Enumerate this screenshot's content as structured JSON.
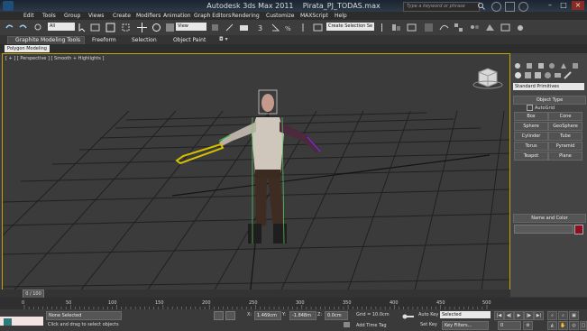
{
  "app": {
    "title": "Autodesk 3ds Max  2011",
    "file": "Pirata_PJ_TODAS.max",
    "search_placeholder": "Type a keyword or phrase"
  },
  "menu": [
    "Edit",
    "Tools",
    "Group",
    "Views",
    "Create",
    "Modifiers",
    "Animation",
    "Graph Editors",
    "Rendering",
    "Customize",
    "MAXScript",
    "Help"
  ],
  "toolbar": {
    "filter": "All",
    "refcoord": "View",
    "selection_set": "Create Selection Se"
  },
  "ribbon": {
    "tabs": [
      "Graphite Modeling Tools",
      "Freeform",
      "Selection",
      "Object Paint"
    ],
    "sub": "Polygon Modeling"
  },
  "viewport": {
    "label": "[ + ] [ Perspective ] [ Smooth + Highlights ]"
  },
  "command_panel": {
    "dropdown": "Standard Primitives",
    "rollout_object_type": "Object Type",
    "autogrid": "AutoGrid",
    "buttons": [
      "Box",
      "Cone",
      "Sphere",
      "GeoSphere",
      "Cylinder",
      "Tube",
      "Torus",
      "Pyramid",
      "Teapot",
      "Plane"
    ],
    "rollout_name_color": "Name and Color",
    "color": "#8a1022"
  },
  "timeline": {
    "frame": "0 / 100",
    "ticks": [
      "0",
      "50",
      "100",
      "150",
      "200",
      "250",
      "300",
      "350",
      "400",
      "450",
      "500"
    ]
  },
  "status": {
    "selection": "None Selected",
    "prompt": "Click and drag to select objects",
    "x_label": "X:",
    "x_value": "1.469cm",
    "y_label": "Y:",
    "y_value": "-1.848m",
    "z_label": "Z:",
    "z_value": "0.0cm",
    "grid": "Grid = 10.0cm",
    "add_time_tag": "Add Time Tag",
    "auto_key": "Auto Key",
    "set_key": "Set Key",
    "key_mode": "Selected",
    "key_filters": "Key Filters...",
    "frame_field": "0"
  }
}
